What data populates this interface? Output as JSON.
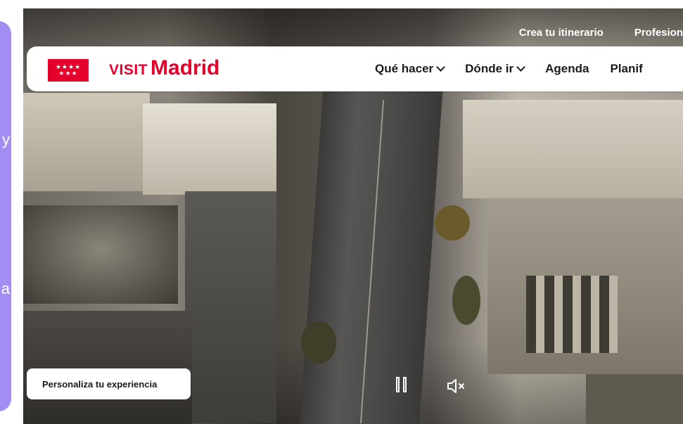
{
  "side_panel": {
    "fragment_1": "y",
    "fragment_2": "a",
    "color": "#a38cf2"
  },
  "utility_nav": {
    "links": [
      "Crea tu itinerario",
      "Profesion"
    ]
  },
  "brand": {
    "flag_stars_row1": "★★★★",
    "flag_stars_row2": "★★★",
    "logo_visit": "VISIT",
    "logo_madrid": "Madrid",
    "accent_color": "#e4002b"
  },
  "main_nav": {
    "items": [
      {
        "label": "Qué hacer",
        "has_dropdown": true
      },
      {
        "label": "Dónde ir",
        "has_dropdown": true
      },
      {
        "label": "Agenda",
        "has_dropdown": false
      },
      {
        "label": "Planif",
        "has_dropdown": false
      }
    ]
  },
  "controls": {
    "personalize_label": "Personaliza tu experiencia",
    "pause_icon": "pause-icon",
    "mute_icon": "speaker-muted-icon"
  }
}
